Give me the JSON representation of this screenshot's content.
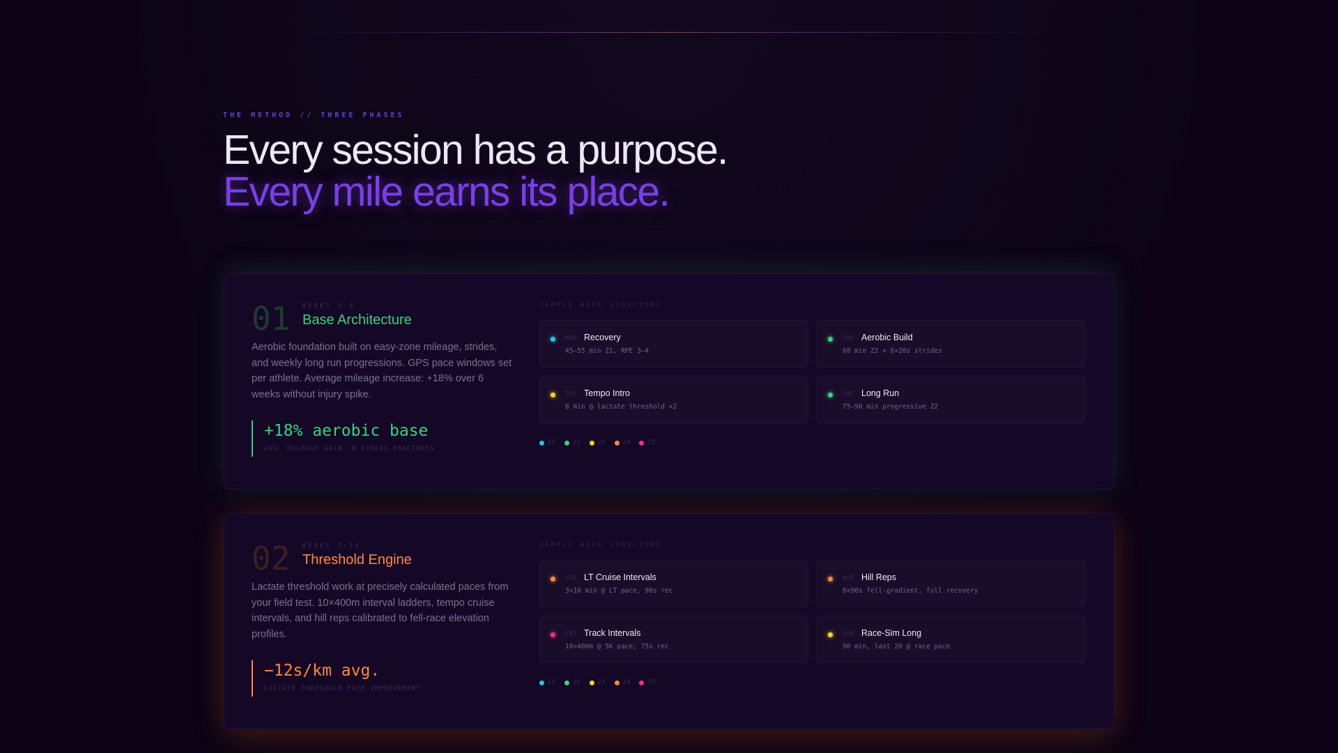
{
  "colors": {
    "background": "#0c0416",
    "accent_purple": "#7a3fe4",
    "zone_z1": "#22c8ea",
    "zone_z2": "#3ed07d",
    "zone_z3": "#f5d02a",
    "zone_z4": "#ff8a3c",
    "zone_z5": "#f0307a"
  },
  "hero": {
    "eyebrow": "THE METHOD // THREE PHASES",
    "headline_line1": "Every session has a purpose.",
    "headline_line2": "Every mile earns its place."
  },
  "phases": [
    {
      "number": "01",
      "weeks": "WEEKS 1–6",
      "title": "Base Architecture",
      "description": "Aerobic foundation built on easy-zone mileage, strides, and weekly long run progressions. GPS pace windows set per athlete. Average mileage increase: +18% over 6 weeks without injury spike.",
      "stat_value": "+18% aerobic base",
      "stat_label": "AVG. MILEAGE GAIN, 0 STRESS FRACTURES",
      "week_label": "SAMPLE WEEK STRUCTURE",
      "sessions": [
        {
          "day": "MON",
          "name": "Recovery",
          "detail": "45–55 min Z1, RPE 3–4",
          "zone_color": "#22c8ea",
          "icon": "zone-dot"
        },
        {
          "day": "TUE",
          "name": "Aerobic Build",
          "detail": "60 min Z2 + 6×20s strides",
          "zone_color": "#3ed07d",
          "icon": "zone-dot"
        },
        {
          "day": "THU",
          "name": "Tempo Intro",
          "detail": "8 min @ lactate threshold ×2",
          "zone_color": "#f5d02a",
          "icon": "zone-dot"
        },
        {
          "day": "SAT",
          "name": "Long Run",
          "detail": "75–90 min progressive Z2",
          "zone_color": "#3ed07d",
          "icon": "zone-dot"
        }
      ],
      "legend": [
        {
          "label": "Z1",
          "color": "#22c8ea"
        },
        {
          "label": "Z2",
          "color": "#3ed07d"
        },
        {
          "label": "Z3",
          "color": "#f5d02a"
        },
        {
          "label": "Z4",
          "color": "#ff8a3c"
        },
        {
          "label": "Z5",
          "color": "#f0307a"
        }
      ]
    },
    {
      "number": "02",
      "weeks": "WEEKS 7–16",
      "title": "Threshold Engine",
      "description": "Lactate threshold work at precisely calculated paces from your field test. 10×400m interval ladders, tempo cruise intervals, and hill reps calibrated to fell-race elevation profiles.",
      "stat_value": "−12s/km avg.",
      "stat_label": "LACTATE THRESHOLD PACE IMPROVEMENT",
      "week_label": "SAMPLE WEEK STRUCTURE",
      "sessions": [
        {
          "day": "TUE",
          "name": "LT Cruise Intervals",
          "detail": "3×10 min @ LT pace, 90s rec",
          "zone_color": "#ff8a3c",
          "icon": "zone-dot"
        },
        {
          "day": "WED",
          "name": "Hill Reps",
          "detail": "8×90s fell-gradient, full recovery",
          "zone_color": "#ff8a3c",
          "icon": "zone-dot"
        },
        {
          "day": "FRI",
          "name": "Track Intervals",
          "detail": "10×400m @ 5K pace, 75s rec",
          "zone_color": "#f0307a",
          "icon": "zone-dot"
        },
        {
          "day": "SUN",
          "name": "Race-Sim Long",
          "detail": "90 min, last 20 @ race pace",
          "zone_color": "#f5d02a",
          "icon": "zone-dot"
        }
      ],
      "legend": [
        {
          "label": "Z1",
          "color": "#22c8ea"
        },
        {
          "label": "Z2",
          "color": "#3ed07d"
        },
        {
          "label": "Z3",
          "color": "#f5d02a"
        },
        {
          "label": "Z4",
          "color": "#ff8a3c"
        },
        {
          "label": "Z5",
          "color": "#f0307a"
        }
      ]
    }
  ]
}
